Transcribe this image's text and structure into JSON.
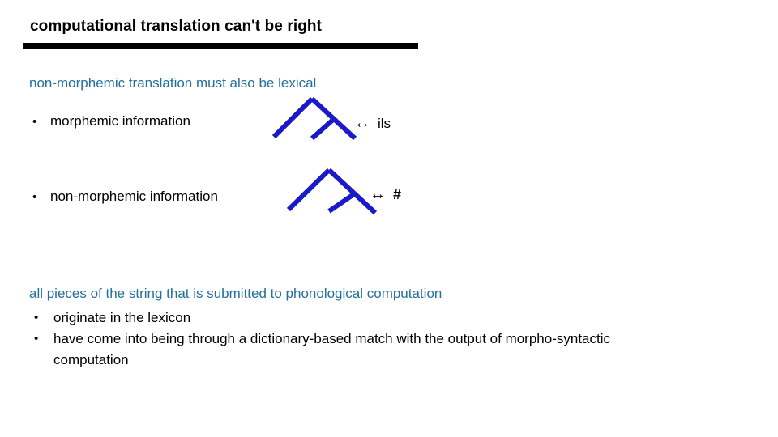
{
  "slide": {
    "title": "computational translation can't be right",
    "subtitle": "non-morphemic translation must also be lexical",
    "bullet_marker": "•",
    "correspondence_arrow": "↔",
    "tree_color": "#1A1AC8",
    "accent_color": "#23709C",
    "text_color": "#000000",
    "rule_color": "#000000",
    "background_color": "#ffffff"
  },
  "pairs": [
    {
      "label": "morphemic information",
      "diagram": "syntactic-tree-right-adjunction",
      "arrow": "↔",
      "gloss": "ils",
      "gloss_bold": false
    },
    {
      "label": "non-morphemic information",
      "diagram": "syntactic-tree-right-adjunction",
      "arrow": "↔",
      "gloss": "#",
      "gloss_bold": true
    }
  ],
  "summary": {
    "lead": "all pieces of the string that is submitted to phonological computation",
    "items": [
      "originate in the lexicon",
      "have come into being through a dictionary-based match with the output of morpho-syntactic computation"
    ]
  }
}
